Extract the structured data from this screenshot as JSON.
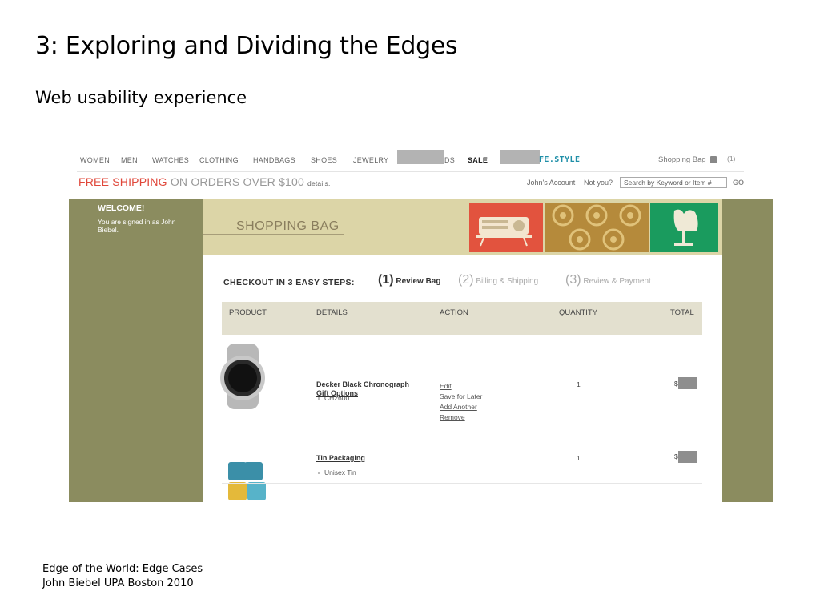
{
  "slide": {
    "title": "3: Exploring and Dividing the Edges",
    "subtitle": "Web usability experience",
    "footer_line1": "Edge of the World: Edge Cases",
    "footer_line2": "John Biebel UPA Boston 2010"
  },
  "site": {
    "nav": [
      "WOMEN",
      "MEN",
      "WATCHES",
      "CLOTHING",
      "HANDBAGS",
      "SHOES",
      "JEWELRY",
      "DS",
      "SALE"
    ],
    "brand_partial": "FE.STYLE",
    "shopping_bag": "Shopping Bag",
    "bag_count": "(1)",
    "promo_highlight": "FREE SHIPPING",
    "promo_rest": " ON ORDERS OVER $100",
    "promo_details": "details.",
    "account": "John's Account",
    "not_you": "Not you?",
    "search_value": "Search by Keyword or Item #",
    "go": "GO",
    "welcome_heading": "WELCOME!",
    "welcome_text": "You are signed in as John Biebel.",
    "banner_title": "SHOPPING BAG",
    "checkout_lead": "CHECKOUT IN 3 EASY STEPS:",
    "steps": [
      {
        "num": "(1)",
        "label": "Review Bag"
      },
      {
        "num": "(2)",
        "label": "Billing & Shipping"
      },
      {
        "num": "(3)",
        "label": "Review & Payment"
      }
    ],
    "columns": [
      "PRODUCT",
      "DETAILS",
      "ACTION",
      "QUANTITY",
      "TOTAL"
    ],
    "items": [
      {
        "name": "Decker Black Chronograph",
        "attribute": "CH2600",
        "gift": "Gift Options",
        "actions": [
          "Edit",
          "Save for Later",
          "Add Another",
          "Remove"
        ],
        "quantity": "1",
        "currency": "$"
      },
      {
        "name": "Tin Packaging",
        "attribute": "Unisex Tin",
        "quantity": "1",
        "currency": "$"
      }
    ]
  },
  "colors": {
    "olive": "#8b8c5f",
    "banner": "#dcd5a7",
    "promo_red": "#e0473a",
    "brand_teal": "#1f8fa8",
    "table_header": "#e3e0cf"
  }
}
